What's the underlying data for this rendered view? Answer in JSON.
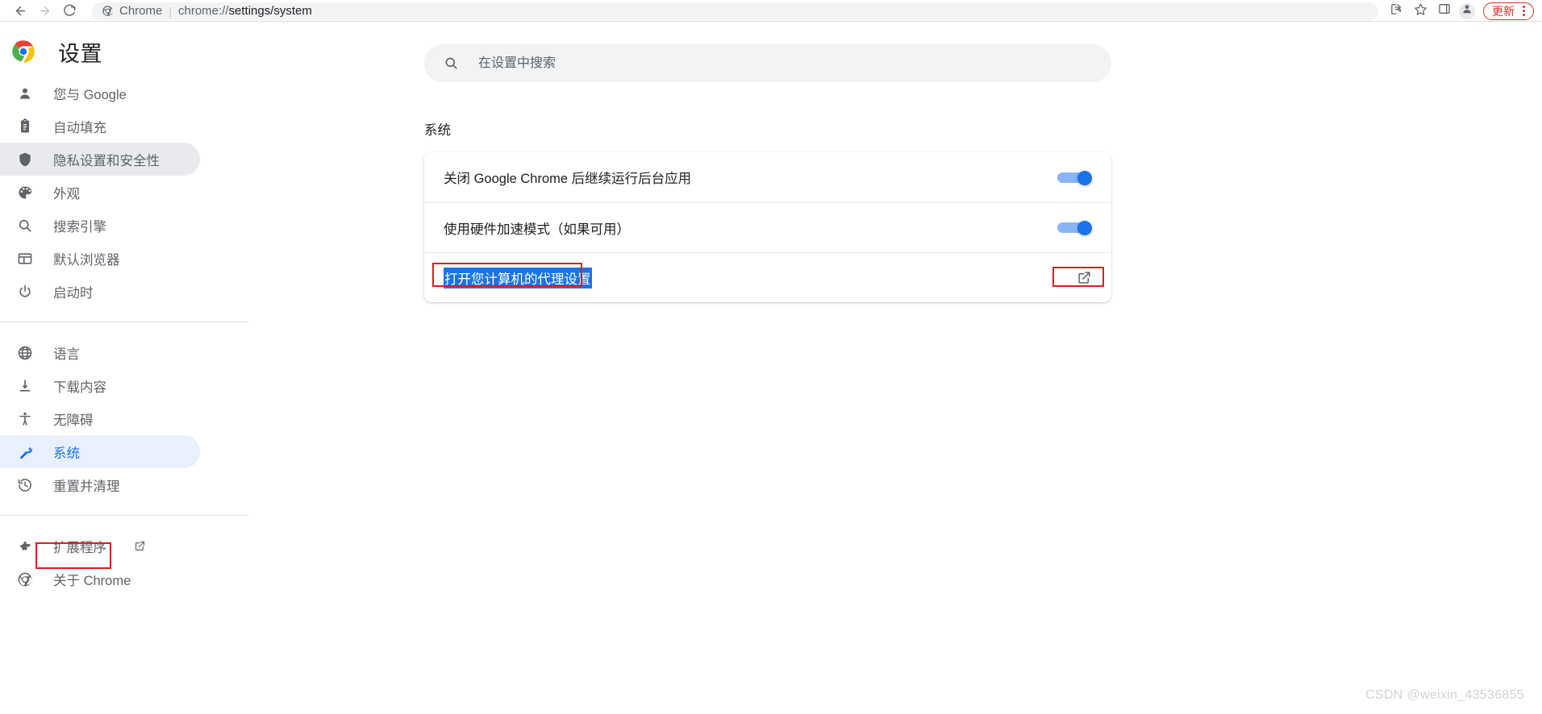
{
  "browser": {
    "back_icon": "back-arrow-icon",
    "forward_icon": "forward-arrow-icon",
    "reload_icon": "reload-icon",
    "omnibox": {
      "chrome_label": "Chrome",
      "separator": "|",
      "url_prefix": "chrome://",
      "url_bold": "settings/system",
      "full_url": "chrome://settings/system"
    },
    "actions": {
      "share_icon": "share-icon",
      "bookmark_icon": "star-icon",
      "side_panel_icon": "side-panel-icon",
      "profile_icon": "profile-avatar-icon",
      "update_label": "更新",
      "menu_icon": "three-dot-menu-icon"
    }
  },
  "sidebar": {
    "brand_title": "设置",
    "brand_logo_icon": "chrome-logo-icon",
    "groups": [
      {
        "items": [
          {
            "label": "您与 Google",
            "icon": "person-icon",
            "state": "normal"
          },
          {
            "label": "自动填充",
            "icon": "clipboard-icon",
            "state": "normal"
          },
          {
            "label": "隐私设置和安全性",
            "icon": "shield-icon",
            "state": "hovered"
          },
          {
            "label": "外观",
            "icon": "palette-icon",
            "state": "normal"
          },
          {
            "label": "搜索引擎",
            "icon": "search-icon",
            "state": "normal"
          },
          {
            "label": "默认浏览器",
            "icon": "browser-window-icon",
            "state": "normal"
          },
          {
            "label": "启动时",
            "icon": "power-icon",
            "state": "normal"
          }
        ]
      },
      {
        "items": [
          {
            "label": "语言",
            "icon": "globe-icon",
            "state": "normal"
          },
          {
            "label": "下载内容",
            "icon": "download-icon",
            "state": "normal"
          },
          {
            "label": "无障碍",
            "icon": "accessibility-icon",
            "state": "normal"
          },
          {
            "label": "系统",
            "icon": "wrench-icon",
            "state": "selected"
          },
          {
            "label": "重置并清理",
            "icon": "history-restore-icon",
            "state": "normal"
          }
        ]
      },
      {
        "items": [
          {
            "label": "扩展程序",
            "icon": "puzzle-icon",
            "state": "normal",
            "trailing_icon": "external-link-icon"
          },
          {
            "label": "关于 Chrome",
            "icon": "chrome-outline-icon",
            "state": "normal"
          }
        ]
      }
    ]
  },
  "search": {
    "placeholder": "在设置中搜索",
    "value": "",
    "icon": "search-icon"
  },
  "main": {
    "section_title": "系统",
    "rows": [
      {
        "label": "关闭 Google Chrome 后继续运行后台应用",
        "control": "toggle",
        "toggle_on": true
      },
      {
        "label": "使用硬件加速模式（如果可用）",
        "control": "toggle",
        "toggle_on": true
      },
      {
        "label": "打开您计算机的代理设置",
        "control": "external-link",
        "control_icon": "external-link-icon",
        "text_selected": true
      }
    ]
  },
  "annotations": {
    "color": "#e21b1b",
    "targets": [
      "sidebar-item-system",
      "proxy-settings-label",
      "proxy-settings-open-icon"
    ]
  },
  "watermark": "CSDN @weixin_43536855",
  "colors": {
    "accent_blue": "#1a73e8",
    "toggle_track": "#8ab4f8",
    "selected_pill": "#e8f0fe",
    "hover_pill": "#e8eaed",
    "update_red": "#d93025",
    "annotation_red": "#e21b1b"
  }
}
